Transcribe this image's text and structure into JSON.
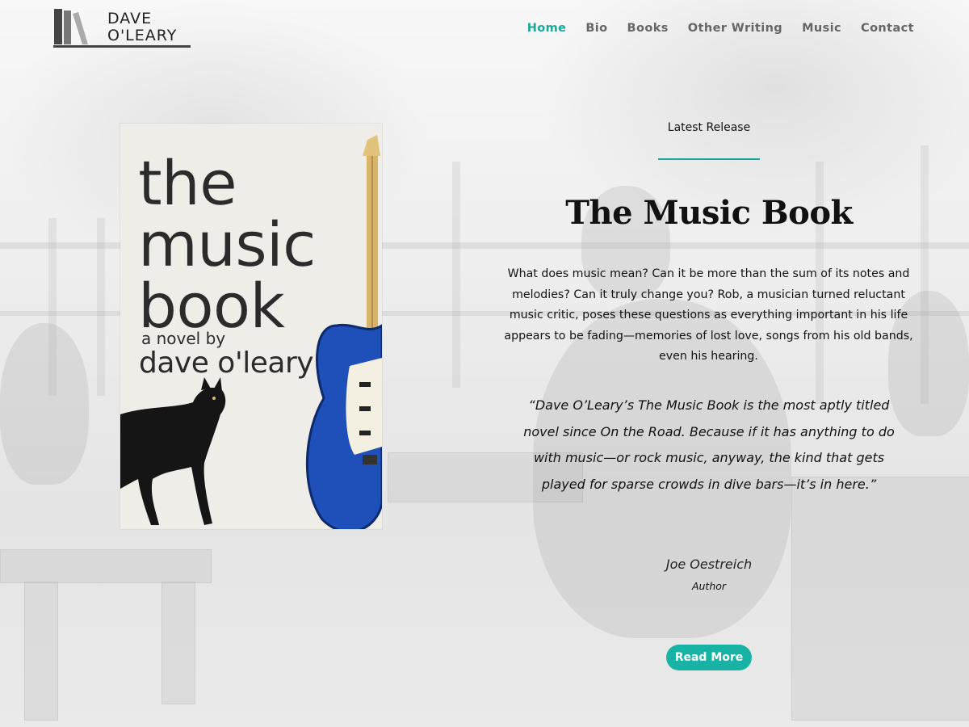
{
  "brand": {
    "line1": "DAVE",
    "line2": "O'LEARY"
  },
  "nav": {
    "items": [
      {
        "label": "Home",
        "active": true
      },
      {
        "label": "Bio"
      },
      {
        "label": "Books"
      },
      {
        "label": "Other Writing"
      },
      {
        "label": "Music"
      },
      {
        "label": "Contact"
      }
    ]
  },
  "cover": {
    "title_lines": [
      "the",
      "music",
      "book"
    ],
    "byline": "a novel by",
    "author": "dave o'leary"
  },
  "feature": {
    "eyebrow": "Latest Release",
    "title": "The Music Book",
    "description": "What does music mean? Can it be more than the sum of its notes and melodies? Can it truly change you? Rob, a musician turned reluctant music critic, poses these questions as everything important in his life appears to be fading—memories of lost love, songs from his old bands, even his hearing.",
    "quote": "“Dave O’Leary’s The Music Book is the most aptly titled novel since On the Road. Because if it has anything to do with music—or rock music, anyway, the kind that gets played for sparse crowds in dive bars—it’s in here.”",
    "quote_author": "Joe Oestreich",
    "quote_role": "Author",
    "cta": "Read More"
  },
  "colors": {
    "accent": "#19a99c",
    "button": "#19b3a5",
    "nav_text": "#666666",
    "guitar_blue": "#1f4fb8"
  }
}
